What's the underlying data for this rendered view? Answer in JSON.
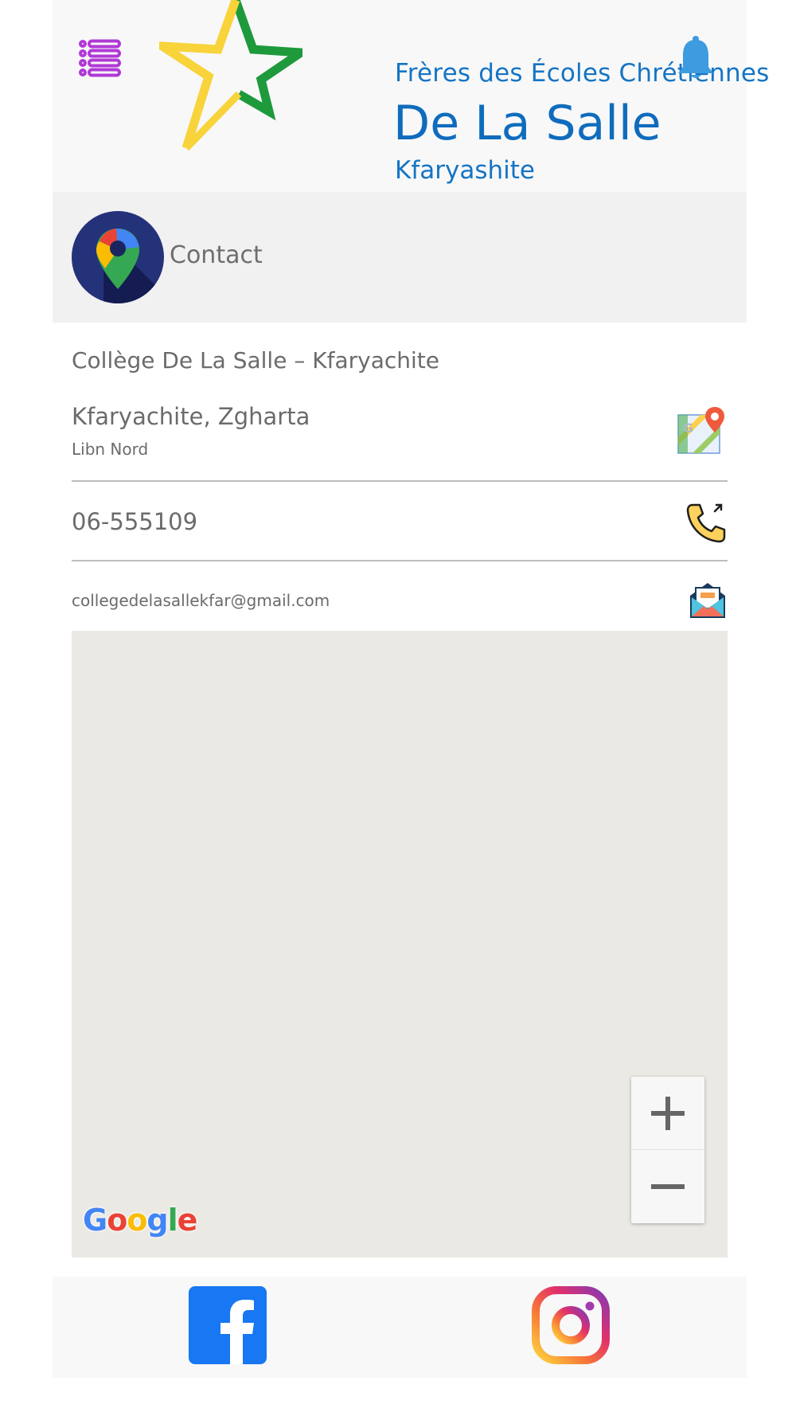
{
  "header": {
    "logo_line1": "Frères des Écoles Chrétiennes",
    "logo_line2": "De La Salle",
    "logo_line3": "Kfaryashite",
    "menu_icon": "list-icon",
    "bell_icon": "bell-icon"
  },
  "contact": {
    "title": "Contact",
    "avatar_icon": "google-maps-pin-icon"
  },
  "info": {
    "school_name": "Collège De La Salle – Kfaryachite",
    "address_main": "Kfaryachite, Zgharta",
    "address_sub": "Libn Nord",
    "phone": "06-555109",
    "email": "collegedelasallekfar@gmail.com",
    "maps_icon": "google-maps-icon",
    "phone_icon": "phone-call-icon",
    "mail_icon": "open-mail-icon"
  },
  "map": {
    "zoom_in_label": "+",
    "zoom_out_label": "−",
    "attribution": "Google"
  },
  "footer": {
    "facebook_icon": "facebook-icon",
    "instagram_icon": "instagram-icon"
  },
  "colors": {
    "brand_blue": "#1574c4",
    "menu_purple": "#b139d6",
    "bell_blue": "#3d9be0",
    "map_bg": "#ebe9e3",
    "facebook_blue": "#1877f2"
  }
}
